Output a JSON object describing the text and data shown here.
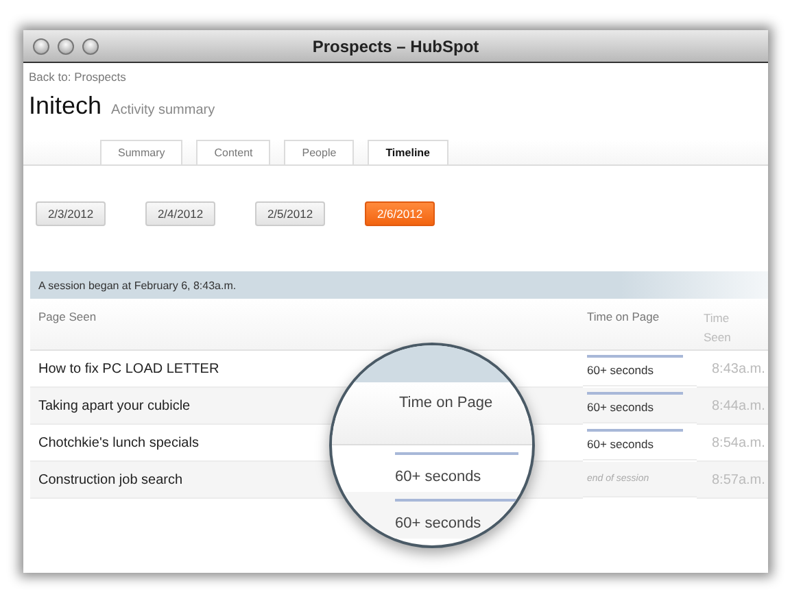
{
  "window": {
    "title": "Prospects – HubSpot"
  },
  "back_link": "Back to: Prospects",
  "company": "Initech",
  "subtitle": "Activity summary",
  "tabs": [
    {
      "label": "Summary",
      "selected": false
    },
    {
      "label": "Content",
      "selected": false
    },
    {
      "label": "People",
      "selected": false
    },
    {
      "label": "Timeline",
      "selected": true
    }
  ],
  "dates": [
    {
      "label": "2/3/2012",
      "selected": false
    },
    {
      "label": "2/4/2012",
      "selected": false
    },
    {
      "label": "2/5/2012",
      "selected": false
    },
    {
      "label": "2/6/2012",
      "selected": true
    }
  ],
  "session_banner": "A session began at February 6, 8:43a.m.",
  "table": {
    "columns": [
      "Page Seen",
      "Time on Page",
      "Time Seen"
    ],
    "rows": [
      {
        "page": "How to fix PC LOAD LETTER",
        "time_on_page": "60+ seconds",
        "kind": "duration",
        "time_seen": "8:43a.m."
      },
      {
        "page": "Taking apart your cubicle",
        "time_on_page": "60+ seconds",
        "kind": "duration",
        "time_seen": "8:44a.m."
      },
      {
        "page": "Chotchkie's lunch specials",
        "time_on_page": "60+ seconds",
        "kind": "duration",
        "time_seen": "8:54a.m."
      },
      {
        "page": "Construction job search",
        "time_on_page": "end of session",
        "kind": "end",
        "time_seen": "8:57a.m."
      }
    ]
  },
  "magnifier": {
    "header": "Time on Page",
    "values": [
      "60+ seconds",
      "60+ seconds"
    ]
  }
}
